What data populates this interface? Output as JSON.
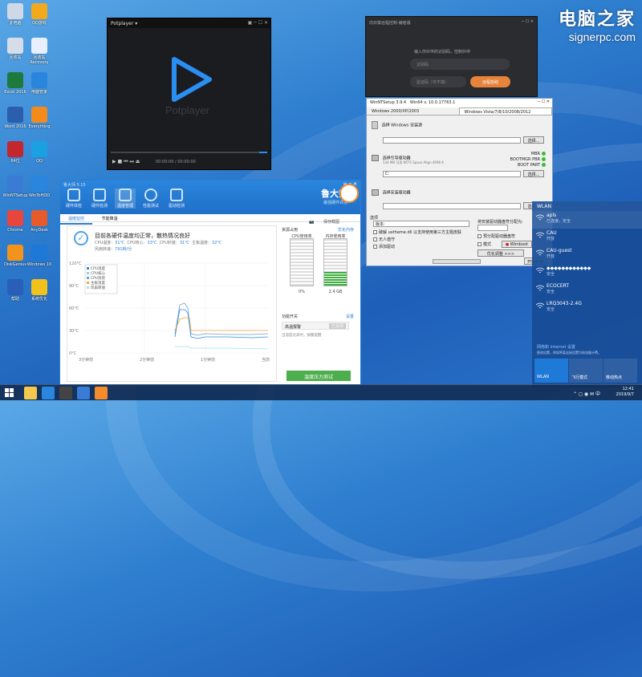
{
  "watermark": {
    "line1": "电脑之家",
    "line2": "signerpc.com"
  },
  "desktop_icons": [
    {
      "label": "此电脑",
      "color": "#cfd8e6"
    },
    {
      "label": "QQ游戏",
      "color": "#f2a91c"
    },
    {
      "label": "回收站",
      "color": "#d6dde8"
    },
    {
      "label": "回收站Recovery",
      "color": "#e8f0ff"
    },
    {
      "label": "Excel 2016",
      "color": "#1e7a3c"
    },
    {
      "label": "电脑管家",
      "color": "#2a86dd"
    },
    {
      "label": "Word 2016",
      "color": "#2b5fad"
    },
    {
      "label": "Everything",
      "color": "#f28b1c"
    },
    {
      "label": "64位",
      "color": "#c4262e"
    },
    {
      "label": "QQ",
      "color": "#1ba1e2"
    },
    {
      "label": "WinNTSetup",
      "color": "#3a7bd5"
    },
    {
      "label": "WinToHDD",
      "color": "#2a86dd"
    },
    {
      "label": "Chrome",
      "color": "#e8453c"
    },
    {
      "label": "AnyDesk",
      "color": "#e85a2a"
    },
    {
      "label": "DiskGenius",
      "color": "#f2931c"
    },
    {
      "label": "Windows 10",
      "color": "#1e78d7"
    },
    {
      "label": "帮助",
      "color": "#2a5fb8"
    },
    {
      "label": "系统优化",
      "color": "#f2c21c"
    }
  ],
  "potplayer": {
    "title": "Potplayer ▾",
    "brand": "Potplayer",
    "time": "00:00:00 / 00:00:00",
    "accent": "#2a8ef2",
    "controls": [
      "▶",
      "■",
      "⏮",
      "⏭",
      "⏏"
    ]
  },
  "dark_window": {
    "title": "向日葵远程控制-编者版",
    "hint": "输入你伙伴的识别码，控制伙伴",
    "id_placeholder": "识别码",
    "code_placeholder": "验证码（可不填）",
    "connect_label": "远程协助",
    "accent": "#e8833a"
  },
  "wnt": {
    "title": "WinNTSetup 3.9.4",
    "title2": "Win64 v. 10.0.17763.1",
    "tab1": "Windows 2000/XP/2003",
    "tab2": "Windows Vista/7/8/10/2008/2012",
    "sec1": "选择 Windows 安装源",
    "sec2": "选择引导驱动器",
    "sec2_info": "534 MB 可用 NTFS Space Align 4096 K",
    "drive": "C:",
    "sec3": "选择安装驱动器",
    "browse": "选择...",
    "mbr": "MBR",
    "bootmgr": "BOOTMGR PBR",
    "bootpart": "BOOT PART",
    "options_head": "选项",
    "version_label": "版本:",
    "opt1": "破解 uxtheme.dll 以支持使用第三方主题皮肤",
    "opt2": "无人值守",
    "opt3": "添加驱动",
    "mount_label": "将安装驱动器盘符分配为:",
    "opt4": "预分配驱动器盘符",
    "mode_label": "模式",
    "mode_val": "Wimboot",
    "tweaks": "优化调整 >>>",
    "setup_btn": "开始安装"
  },
  "ludashi": {
    "title": "鲁大师 5.15",
    "nav": [
      "硬件体检",
      "硬件检测",
      "温度管理",
      "性能测试",
      "驱动检测"
    ],
    "brand": "鲁大师",
    "brand_sub": "最强硬件评测",
    "subtab1": "温度监控",
    "subtab2": "节能降温",
    "subtab_right": "保存截图",
    "status": "目前各硬件温度均正常，散热情况良好",
    "cpu_temp_label": "CPU温度：",
    "cpu_temp": "31℃",
    "core_label": "CPU核心：",
    "core_temp": "33℃",
    "pkg_label": "CPU封装：",
    "pkg_temp": "31℃",
    "mb_label": "主板温度：",
    "mb_temp": "32℃",
    "fan_label": "风扇转速：",
    "fan_rpm": "791转/分",
    "legend": [
      "CPU温度",
      "CPU核心",
      "CPU封装",
      "主板温度",
      "风扇转速"
    ],
    "ylabels": [
      "120°C",
      "90°C",
      "60°C",
      "30°C",
      "0°C"
    ],
    "xlabels": [
      "3分钟前",
      "2分钟前",
      "1分钟前",
      "当前"
    ],
    "res_head": "资源占用",
    "res_link": "优化内存",
    "cpu_usage": "CPU使用率",
    "mem_usage": "内存使用率",
    "cpu_val": "0%",
    "mem_val": "2.4 GB",
    "mem_fill": 0.3,
    "func_head": "功能开关",
    "func_link": "设置",
    "alarm": "高温报警",
    "alarm_state": "已关闭",
    "alarm_desc": "当温度过高时，报警提醒",
    "stress_btn": "温度压力测试"
  },
  "wlan": {
    "head": "WLAN",
    "networks": [
      {
        "name": "apls",
        "status": "已连接，安全"
      },
      {
        "name": "CAU",
        "status": "开放"
      },
      {
        "name": "CAU-guest",
        "status": "开放"
      },
      {
        "name": "◆◆◆◆◆◆◆◆◆◆◆◆",
        "status": "安全"
      },
      {
        "name": "ECOCERT",
        "status": "安全"
      },
      {
        "name": "LRQ3043-2.4G",
        "status": "安全"
      }
    ],
    "settings_link": "网络和 Internet 设置",
    "settings_desc": "更改设置，例如将某连接设置为按流量计费。",
    "tiles": [
      "WLAN",
      "飞行模式",
      "移动热点"
    ]
  },
  "taskbar": {
    "time": "12:41",
    "date": "2019/9/7",
    "tray": "⌃ ◻ ◉ ✉ 中"
  }
}
